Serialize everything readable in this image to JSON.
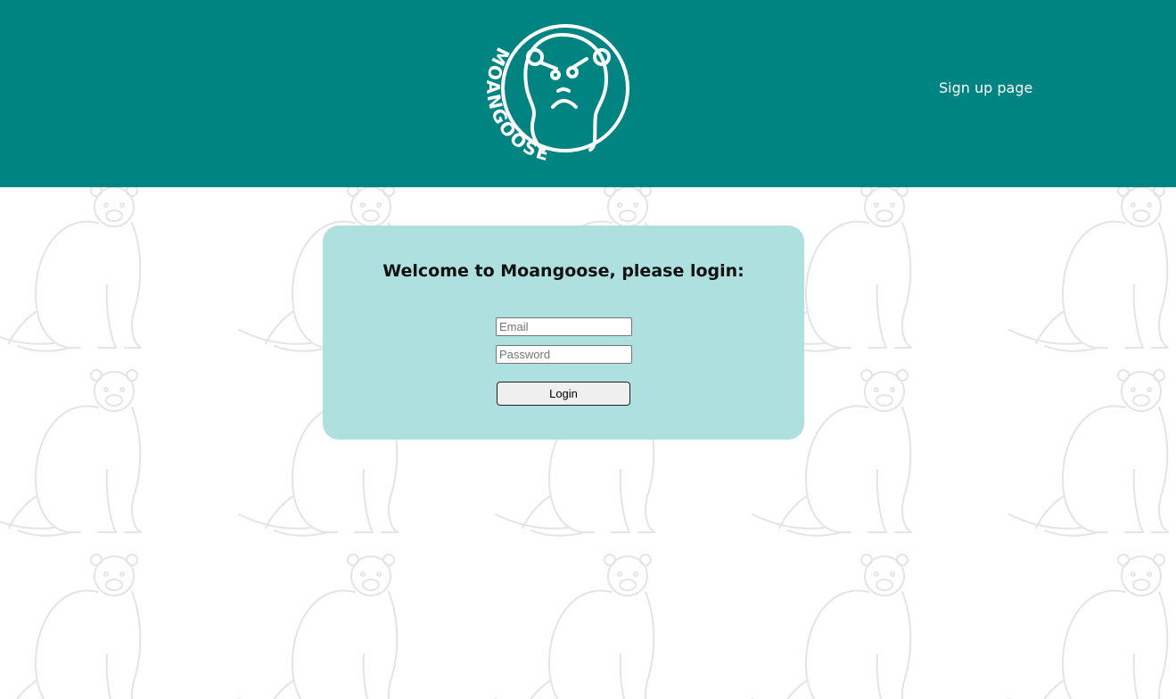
{
  "header": {
    "logo_text": "MOANGOOSE",
    "nav_signup": "Sign up page",
    "background_color": "#008482"
  },
  "login": {
    "title": "Welcome to Moangoose, please login:",
    "email_placeholder": "Email",
    "password_placeholder": "Password",
    "submit_label": "Login",
    "card_color": "#aee0e0"
  },
  "background": {
    "pattern_icon": "ferret-outline-icon"
  }
}
